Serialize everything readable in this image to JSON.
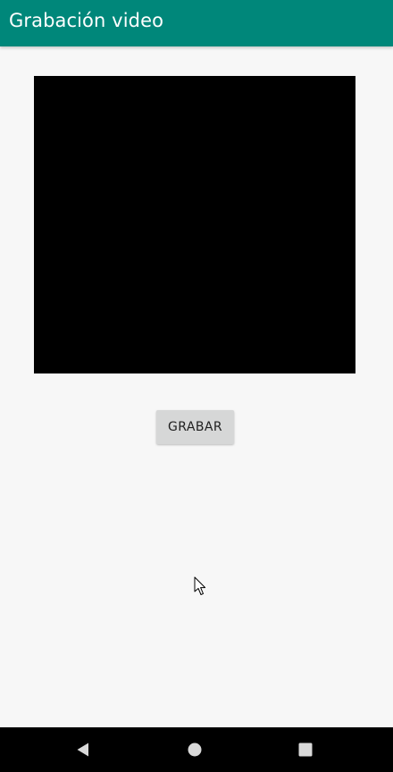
{
  "app_bar": {
    "title": "Grabación video",
    "color": "#00877A"
  },
  "main": {
    "record_button_label": "GRABAR",
    "video_surface_color": "#000000"
  },
  "nav_bar": {
    "icons": [
      "back-triangle-icon",
      "home-circle-icon",
      "recents-square-icon"
    ]
  }
}
